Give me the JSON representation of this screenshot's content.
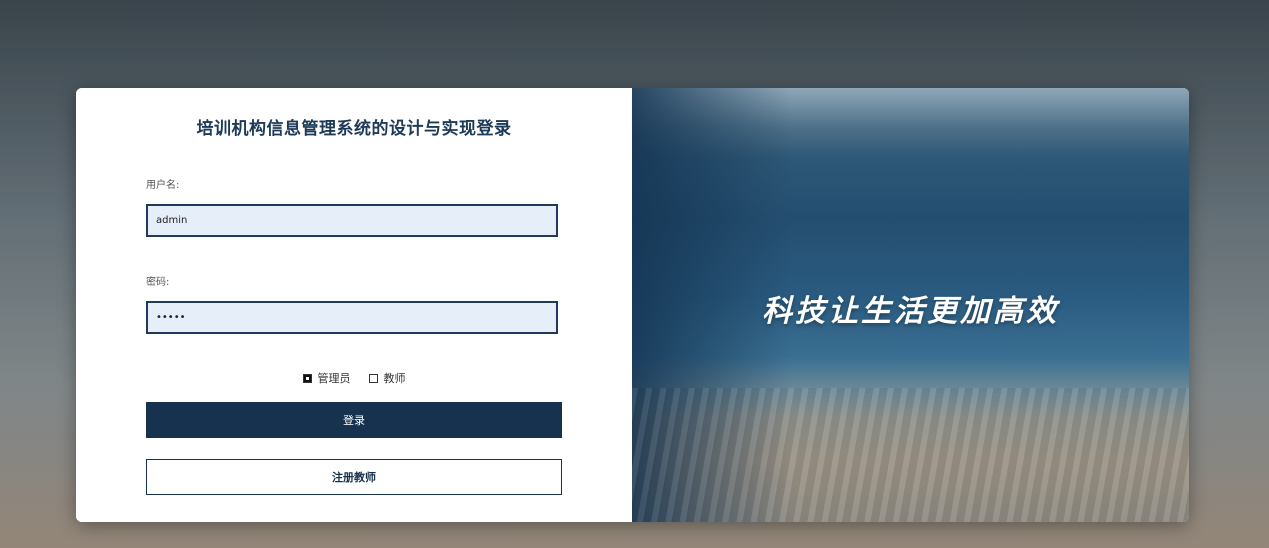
{
  "login": {
    "title": "培训机构信息管理系统的设计与实现登录",
    "username_label": "用户名:",
    "username_value": "admin",
    "password_label": "密码:",
    "password_value": "•••••",
    "roles": [
      {
        "label": "管理员",
        "checked": true
      },
      {
        "label": "教师",
        "checked": false
      }
    ],
    "login_button": "登录",
    "register_button": "注册教师"
  },
  "hero": {
    "tagline": "科技让生活更加高效"
  }
}
